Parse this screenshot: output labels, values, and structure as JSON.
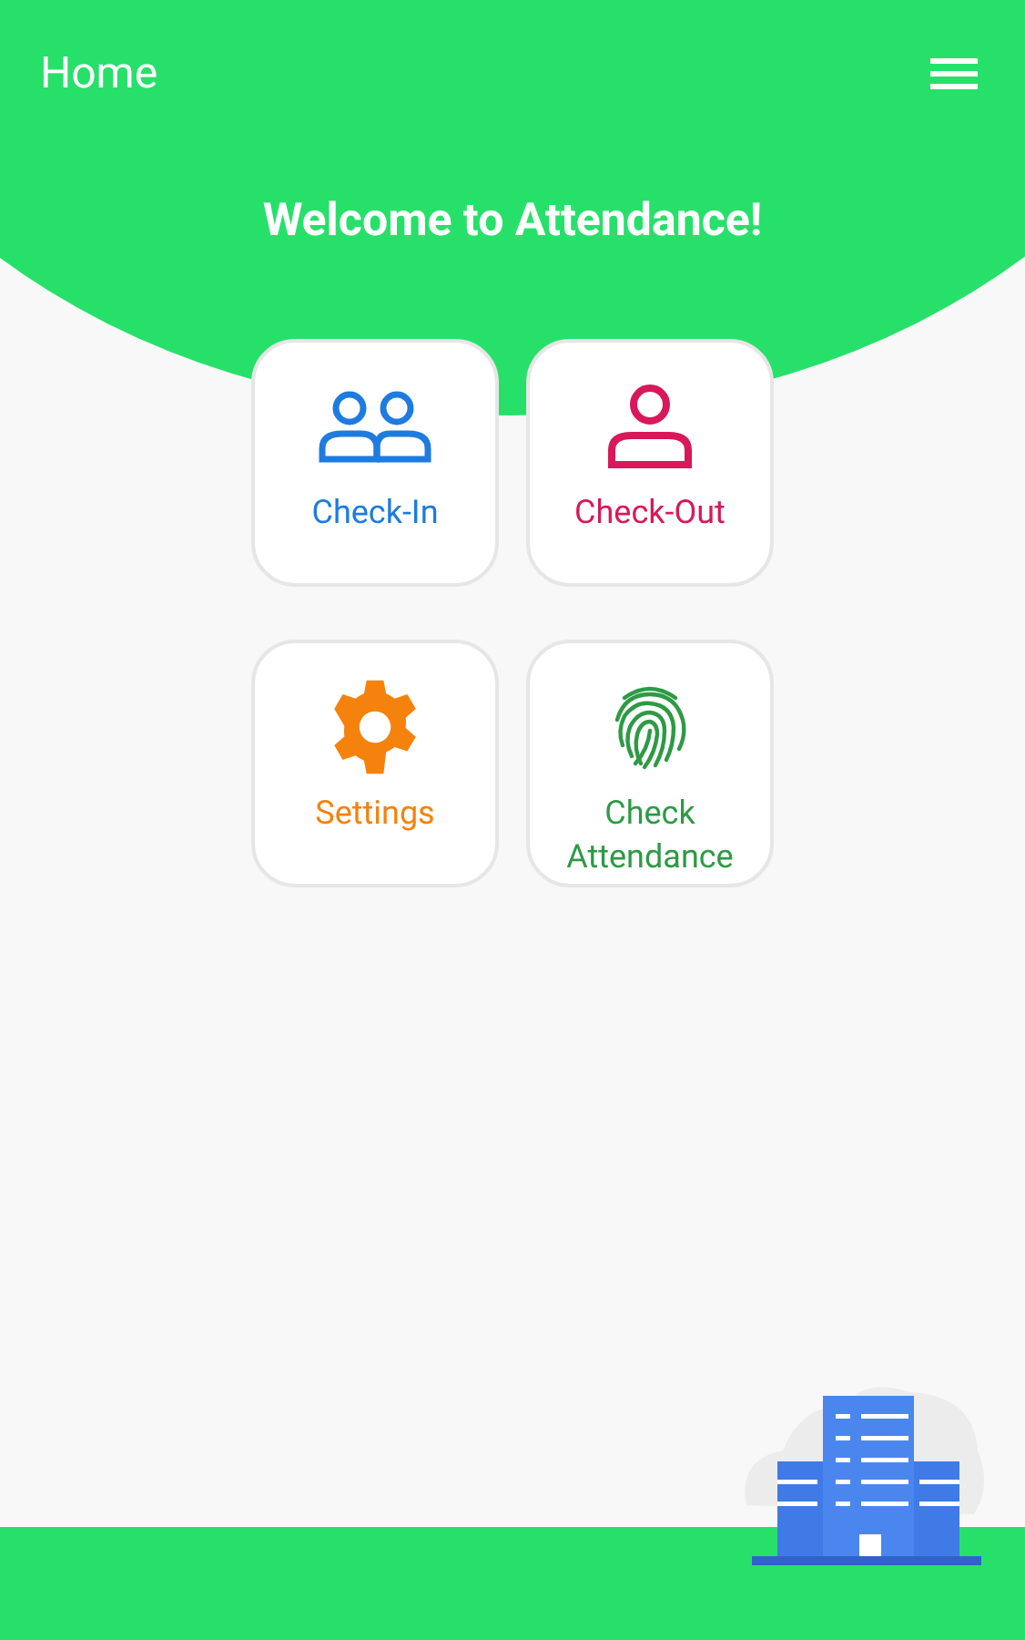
{
  "app_bar": {
    "title": "Home"
  },
  "welcome": "Welcome to Attendance!",
  "tiles": [
    {
      "kind": "people",
      "label": "Check-In",
      "color": "#1e7be0"
    },
    {
      "kind": "person",
      "label": "Check-Out",
      "color": "#d8185a"
    },
    {
      "kind": "gear",
      "label": "Settings",
      "color": "#f5820d"
    },
    {
      "kind": "fingerprint",
      "label": "Check Attendance",
      "color": "#2e9a45"
    }
  ]
}
